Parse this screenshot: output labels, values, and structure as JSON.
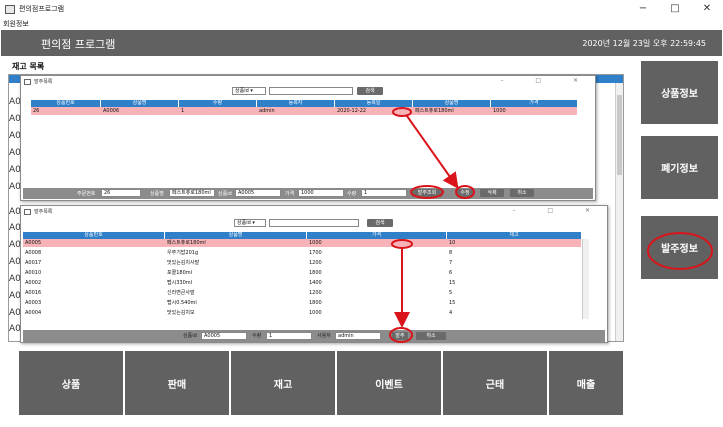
{
  "window": {
    "title": "편의점프로그램",
    "controls": [
      "−",
      "□",
      "✕"
    ]
  },
  "menu": {
    "item": "회원정보"
  },
  "header": {
    "app_name": "편의점 프로그램",
    "clock": "2020년 12월 23일 오후 22:59:45"
  },
  "inventory": {
    "label": "재고 목록",
    "row_codes": [
      "A0",
      "A0",
      "A0",
      "A0",
      "A0",
      "A0",
      "A0",
      "A0",
      "A0",
      "A0",
      "A0",
      "A0",
      "A0",
      "A0"
    ]
  },
  "side_menu": [
    {
      "label": "상품정보"
    },
    {
      "label": "폐기정보"
    },
    {
      "label": "발주정보"
    }
  ],
  "bottom_menu": [
    {
      "label": "상품"
    },
    {
      "label": "판매"
    },
    {
      "label": "재고"
    },
    {
      "label": "이벤트"
    },
    {
      "label": "근태"
    },
    {
      "label": "매출"
    }
  ],
  "order_list_window": {
    "title": "발주목록",
    "search_select": "상품id",
    "search_button": "검색",
    "columns": [
      "상품번호",
      "상품명",
      "수량",
      "등록자",
      "등록일",
      "상품명",
      "가격"
    ],
    "rows": [
      [
        "26",
        "A0006",
        "1",
        "admin",
        "2020-12-22",
        "페스트츄로180ml",
        "1000"
      ]
    ],
    "form": {
      "order_no_label": "주문번호",
      "order_no": "26",
      "product_name_label": "상품명",
      "product_name": "페스트츄로180ml",
      "product_id_label": "상품id",
      "product_id": "A0005",
      "price_label": "가격",
      "price": "1000",
      "qty_label": "수량",
      "qty": "1"
    },
    "buttons": [
      "발주조회",
      "수정",
      "삭제",
      "취소"
    ]
  },
  "product_list_window": {
    "title": "발주목록",
    "search_select": "상품id",
    "search_button": "검색",
    "columns": [
      "상품번호",
      "상품명",
      "가격",
      "재고"
    ],
    "rows": [
      [
        "A0005",
        "페스트츄로180ml",
        "1000",
        "10"
      ],
      [
        "A0008",
        "우쭈기밥201g",
        "1700",
        "8"
      ],
      [
        "A0017",
        "맛있는김치사발",
        "1200",
        "7"
      ],
      [
        "A0010",
        "포콜180ml",
        "1800",
        "6"
      ],
      [
        "A0002",
        "펩시330ml",
        "1400",
        "15"
      ],
      [
        "A0016",
        "신라면큰사발",
        "1200",
        "5"
      ],
      [
        "A0003",
        "펩시0.540ml",
        "1800",
        "15"
      ],
      [
        "A0004",
        "맛있는김치모",
        "1000",
        "4"
      ]
    ],
    "form": {
      "product_id_label": "상품id",
      "product_id": "A0005",
      "qty_label": "수량",
      "qty": "1",
      "user_label": "사용자",
      "user": "admin"
    },
    "buttons": [
      "발주",
      "취소"
    ]
  }
}
